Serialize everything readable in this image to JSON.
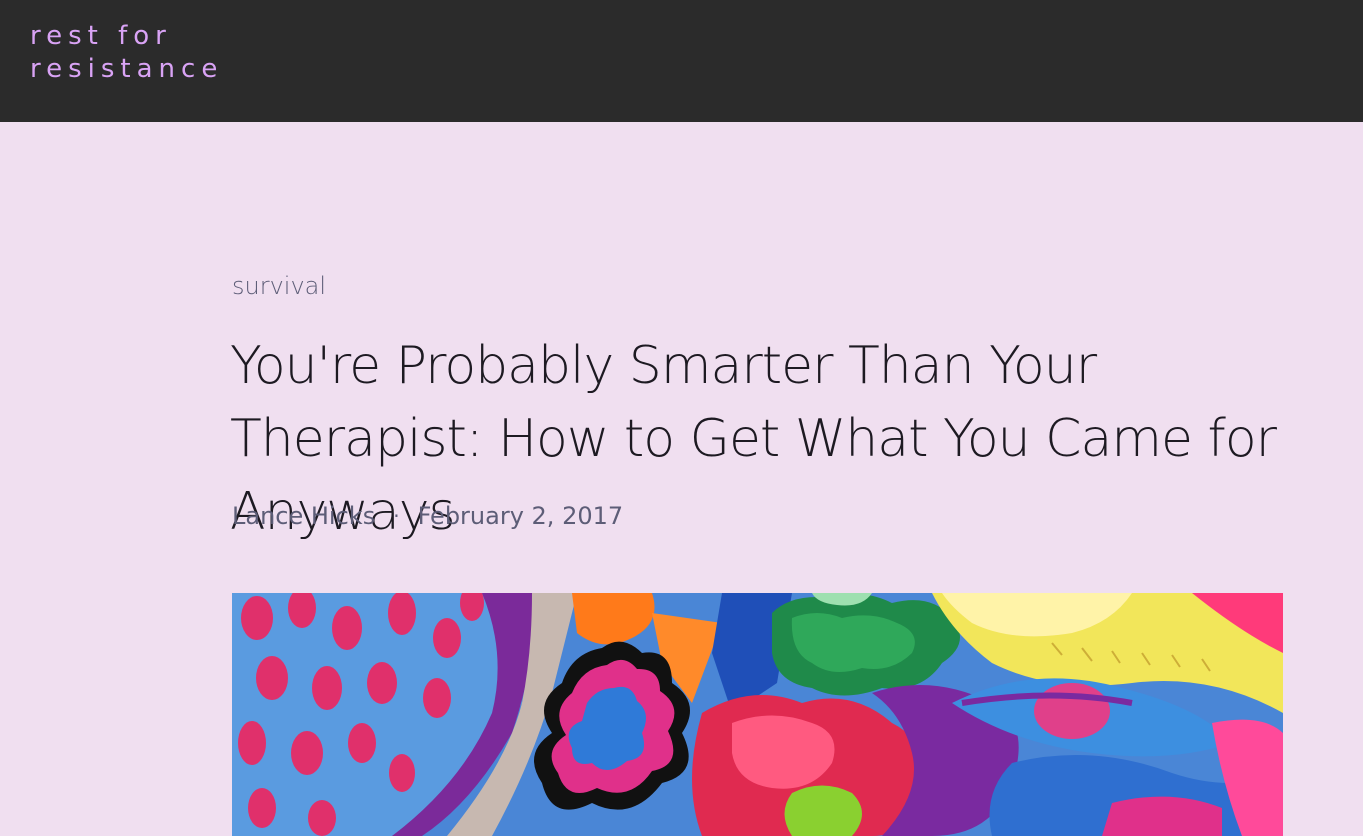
{
  "header": {
    "site_title_line1": "rest for",
    "site_title_line2": "resistance"
  },
  "post": {
    "category": "survival",
    "title": "You're Probably Smarter Than Your Therapist: How to Get What You Came for Anyways",
    "author": "Lance Hicks",
    "separator": "·",
    "date": "February 2, 2017"
  },
  "colors": {
    "header_bg": "#2b2b2b",
    "site_title": "#d9a3f5",
    "page_bg": "#f0dff0",
    "title_text": "#1d1a22",
    "meta_text": "#5d5d77"
  }
}
